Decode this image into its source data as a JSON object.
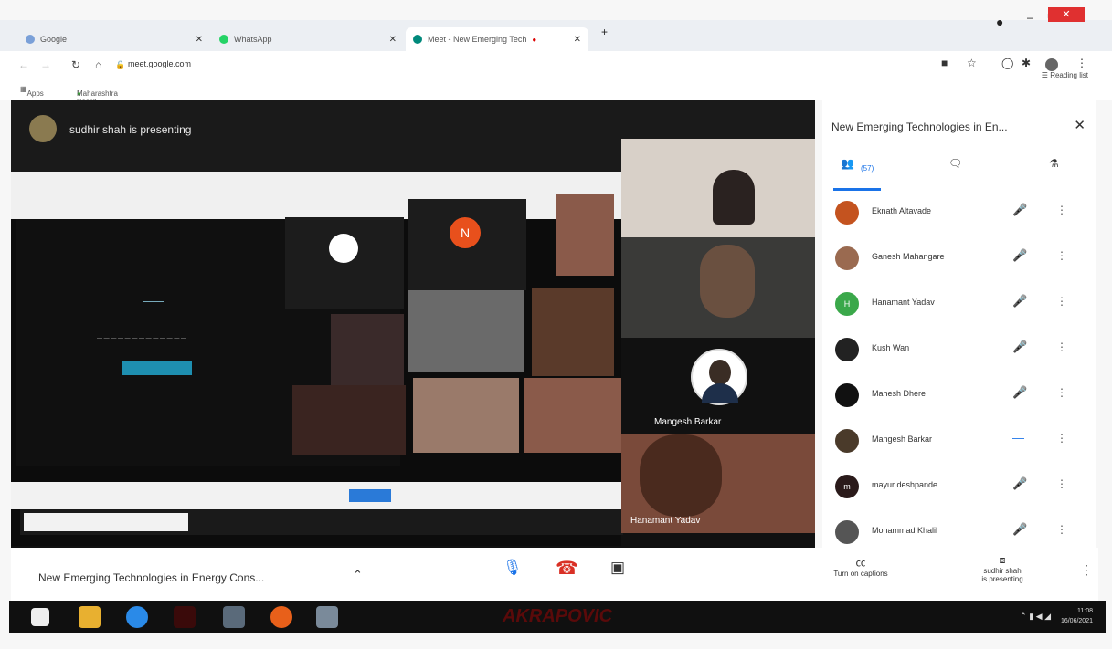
{
  "browser": {
    "tabs": [
      {
        "label": "Google",
        "color": "#7aa0d8"
      },
      {
        "label": "WhatsApp",
        "color": "#25d366"
      },
      {
        "label": "Meet - New Emerging Tech",
        "color": "#00897b"
      }
    ],
    "url": "meet.google.com",
    "reading_list": "Reading list",
    "bookmarks": [
      "Apps",
      "Maharashtra Board"
    ]
  },
  "stage": {
    "presenting_text": "sudhir shah is presenting",
    "participants_visible": [
      "Mangesh Barkar",
      "Hanamant Yadav"
    ]
  },
  "panel": {
    "title": "New Emerging Technologies in En...",
    "count": "(57)",
    "participants": [
      {
        "name": "Eknath Altavade",
        "avatar_color": "#c4531f",
        "initial": "",
        "mic": "muted"
      },
      {
        "name": "Ganesh Mahangare",
        "avatar_color": "#9a6a50",
        "initial": "",
        "mic": "muted"
      },
      {
        "name": "Hanamant Yadav",
        "avatar_color": "#3aa84a",
        "initial": "H",
        "mic": "muted"
      },
      {
        "name": "Kush Wan",
        "avatar_color": "#222222",
        "initial": "",
        "mic": "muted"
      },
      {
        "name": "Mahesh Dhere",
        "avatar_color": "#111111",
        "initial": "",
        "mic": "muted"
      },
      {
        "name": "Mangesh Barkar",
        "avatar_color": "#4a3a2a",
        "initial": "",
        "mic": "active"
      },
      {
        "name": "mayur deshpande",
        "avatar_color": "#2a1a1a",
        "initial": "m",
        "mic": "muted"
      },
      {
        "name": "Mohammad Khalil",
        "avatar_color": "#555555",
        "initial": "",
        "mic": "muted"
      }
    ]
  },
  "controls": {
    "meeting_title": "New Emerging Technologies in Energy Cons...",
    "captions": "Turn on captions",
    "present_status_1": "sudhir shah",
    "present_status_2": "is presenting"
  },
  "taskbar": {
    "watermark": "AKRAPOVIC",
    "time": "11:08",
    "date": "16/06/2021"
  }
}
